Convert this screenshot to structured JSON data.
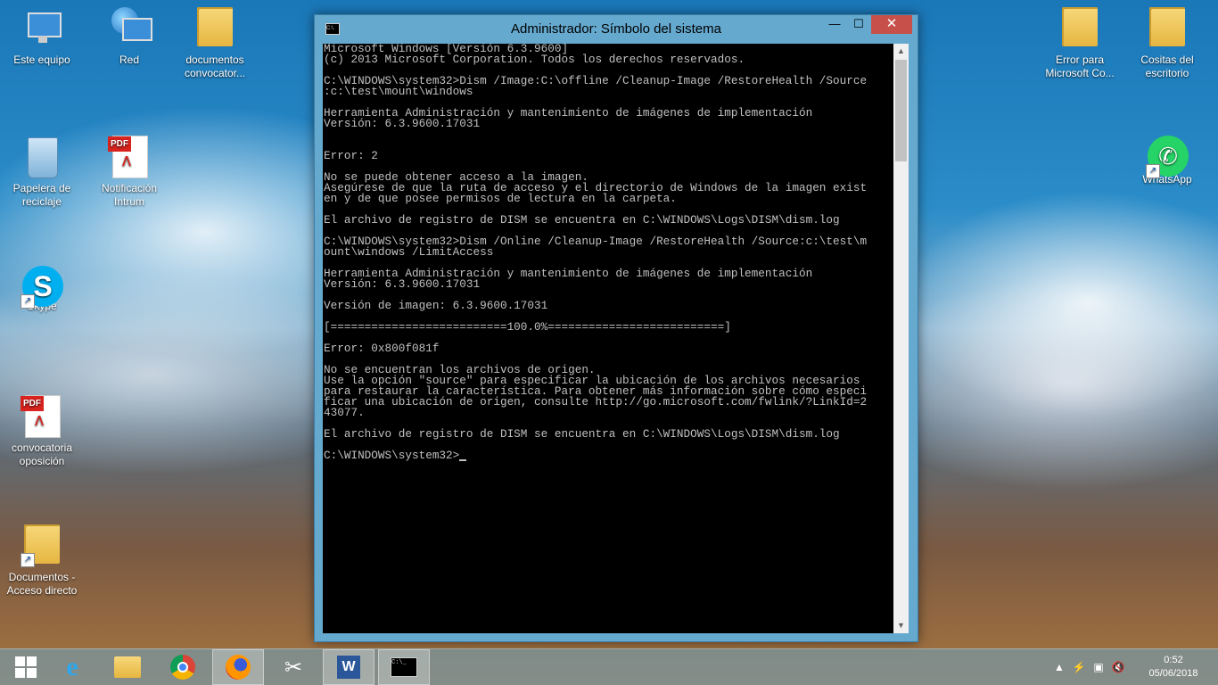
{
  "desktop": {
    "left_icons": [
      {
        "label": "Este equipo"
      },
      {
        "label": "Red"
      },
      {
        "label": "documentos convocator..."
      },
      {
        "label": "Papelera de reciclaje"
      },
      {
        "label": "Notificación Intrum"
      },
      {
        "label": "Skype"
      },
      {
        "label": "convocatoria oposición"
      },
      {
        "label": "Documentos - Acceso directo"
      }
    ],
    "right_icons": [
      {
        "label": "Error para Microsoft Co..."
      },
      {
        "label": "Cositas del escritorio"
      },
      {
        "label": "WhatsApp"
      }
    ]
  },
  "window": {
    "title": "Administrador: Símbolo del sistema",
    "app_icon_text": "C:\\.",
    "minimize": "—",
    "maximize": "☐",
    "close": "✕",
    "console_lines": [
      "Microsoft Windows [Versión 6.3.9600]",
      "(c) 2013 Microsoft Corporation. Todos los derechos reservados.",
      "",
      "C:\\WINDOWS\\system32>Dism /Image:C:\\offline /Cleanup-Image /RestoreHealth /Source",
      ":c:\\test\\mount\\windows",
      "",
      "Herramienta Administración y mantenimiento de imágenes de implementación",
      "Versión: 6.3.9600.17031",
      "",
      "",
      "Error: 2",
      "",
      "No se puede obtener acceso a la imagen.",
      "Asegúrese de que la ruta de acceso y el directorio de Windows de la imagen exist",
      "en y de que posee permisos de lectura en la carpeta.",
      "",
      "El archivo de registro de DISM se encuentra en C:\\WINDOWS\\Logs\\DISM\\dism.log",
      "",
      "C:\\WINDOWS\\system32>Dism /Online /Cleanup-Image /RestoreHealth /Source:c:\\test\\m",
      "ount\\windows /LimitAccess",
      "",
      "Herramienta Administración y mantenimiento de imágenes de implementación",
      "Versión: 6.3.9600.17031",
      "",
      "Versión de imagen: 6.3.9600.17031",
      "",
      "[==========================100.0%==========================]",
      "",
      "Error: 0x800f081f",
      "",
      "No se encuentran los archivos de origen.",
      "Use la opción \"source\" para especificar la ubicación de los archivos necesarios",
      "para restaurar la característica. Para obtener más información sobre cómo especi",
      "ficar una ubicación de origen, consulte http://go.microsoft.com/fwlink/?LinkId=2",
      "43077.",
      "",
      "El archivo de registro de DISM se encuentra en C:\\WINDOWS\\Logs\\DISM\\dism.log",
      "",
      "C:\\WINDOWS\\system32>"
    ]
  },
  "taskbar": {
    "items": [
      {
        "name": "start-button-icon"
      },
      {
        "name": "internet-explorer-icon"
      },
      {
        "name": "file-explorer-icon"
      },
      {
        "name": "chrome-icon"
      },
      {
        "name": "firefox-icon"
      },
      {
        "name": "snipping-tool-icon"
      },
      {
        "name": "word-icon"
      },
      {
        "name": "cmd-icon"
      }
    ],
    "clock_time": "0:52",
    "clock_date": "05/06/2018"
  }
}
